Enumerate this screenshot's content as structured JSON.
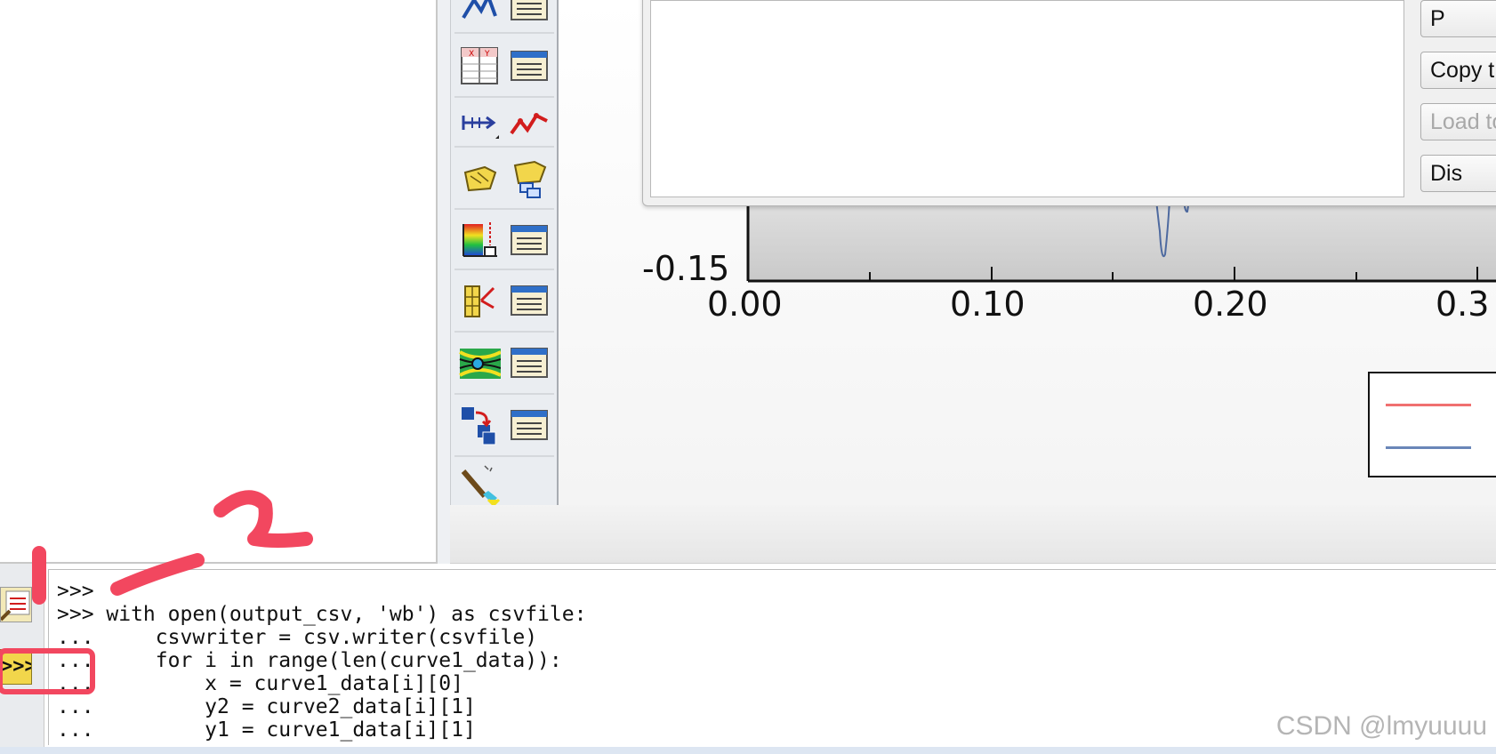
{
  "toolbox": {
    "rows": [
      {
        "left_icon": "create-xy-plot-icon",
        "right_icon": "xy-plot-manager-icon"
      },
      {
        "left_icon": "xy-data-table-icon",
        "right_icon": "xy-data-manager-icon"
      },
      {
        "left_icon": "path-icon",
        "right_icon": "xy-curve-icon"
      },
      {
        "left_icon": "display-group-icon",
        "right_icon": "display-group-stack-icon"
      },
      {
        "left_icon": "contour-options-icon",
        "right_icon": "contour-manager-icon"
      },
      {
        "left_icon": "symbol-options-icon",
        "right_icon": "symbol-manager-icon"
      },
      {
        "left_icon": "stream-icon",
        "right_icon": "stream-manager-icon"
      },
      {
        "left_icon": "transform-icon",
        "right_icon": "transform-manager-icon"
      },
      {
        "left_icon": "color-code-icon",
        "right_icon": ""
      }
    ]
  },
  "dialog": {
    "buttons": [
      {
        "label": "P",
        "state": "enabled"
      },
      {
        "label": "Copy t",
        "state": "enabled"
      },
      {
        "label": "Load to",
        "state": "disabled"
      },
      {
        "label": "Dis",
        "state": "enabled"
      }
    ]
  },
  "plot": {
    "y_tick": "-0.15",
    "x_ticks": [
      "0.00",
      "0.10",
      "0.20",
      "0.3"
    ],
    "legend_colors": [
      "#f07070",
      "#6a86b8"
    ]
  },
  "console": {
    "lines": [
      ">>>",
      ">>> with open(output_csv, 'wb') as csvfile:",
      "...     csvwriter = csv.writer(csvfile)",
      "...     for i in range(len(curve1_data)):",
      "...         x = curve1_data[i][0]",
      "...         y2 = curve2_data[i][1]",
      "...         y1 = curve1_data[i][1]"
    ],
    "side_buttons": [
      "message-area-icon",
      "kernel-command-line-icon"
    ]
  },
  "annotations": {
    "marker_1": "1",
    "marker_2": "2"
  },
  "watermark": "CSDN @lmyuuuu",
  "colors": {
    "annotation_red": "#f2475f",
    "toolbox_bg": "#eaedf1"
  }
}
